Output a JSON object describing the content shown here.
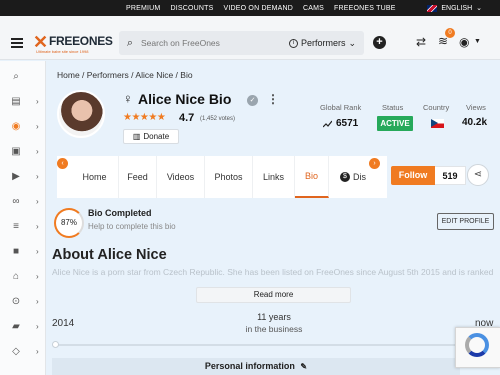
{
  "topbar": {
    "links": [
      "PREMIUM",
      "DISCOUNTS",
      "VIDEO ON DEMAND",
      "CAMS",
      "FREEONES TUBE"
    ],
    "language": "ENGLISH"
  },
  "header": {
    "logo": {
      "word": "FREEONES",
      "tagline": "Ultimate babe site since 1998"
    },
    "search": {
      "placeholder": "Search on FreeOnes",
      "category": "Performers"
    },
    "coins_badge": "0",
    "icons": [
      "menu-icon",
      "search-icon",
      "info-icon",
      "plus-icon",
      "shuffle-icon",
      "coins-icon",
      "user-icon"
    ]
  },
  "breadcrumb": "Home / Performers / Alice Nice / Bio",
  "profile": {
    "name": "Alice Nice Bio",
    "rating": "4.7",
    "votes": "(1,452 votes)",
    "donate_label": "Donate",
    "stars": "★★★★★"
  },
  "stats": {
    "global_rank_label": "Global Rank",
    "global_rank": "6571",
    "status_label": "Status",
    "status": "ACTIVE",
    "country_label": "Country",
    "views_label": "Views",
    "views": "40.2k"
  },
  "tabs": [
    "Home",
    "Feed",
    "Videos",
    "Photos",
    "Links",
    "Bio",
    "Dis"
  ],
  "active_tab": "Bio",
  "follow": {
    "label": "Follow",
    "count": "519"
  },
  "bio_completion": {
    "percent": "87%",
    "title": "Bio Completed",
    "subtitle": "Help to complete this bio",
    "edit_label": "EDIT PROFILE"
  },
  "about": {
    "heading": "About Alice Nice",
    "text": "Alice Nice is a porn star from Czech Republic. She has been listed on FreeOnes since August 5th 2015 and is ranked",
    "read_more": "Read more"
  },
  "career": {
    "start": "2014",
    "years": "11 years",
    "years_sub": "in the business",
    "end": "now"
  },
  "personal_info": "Personal information",
  "colors": {
    "accent": "#f07b21",
    "status_active": "#26a95a",
    "page_bg": "#e8f2fb"
  }
}
